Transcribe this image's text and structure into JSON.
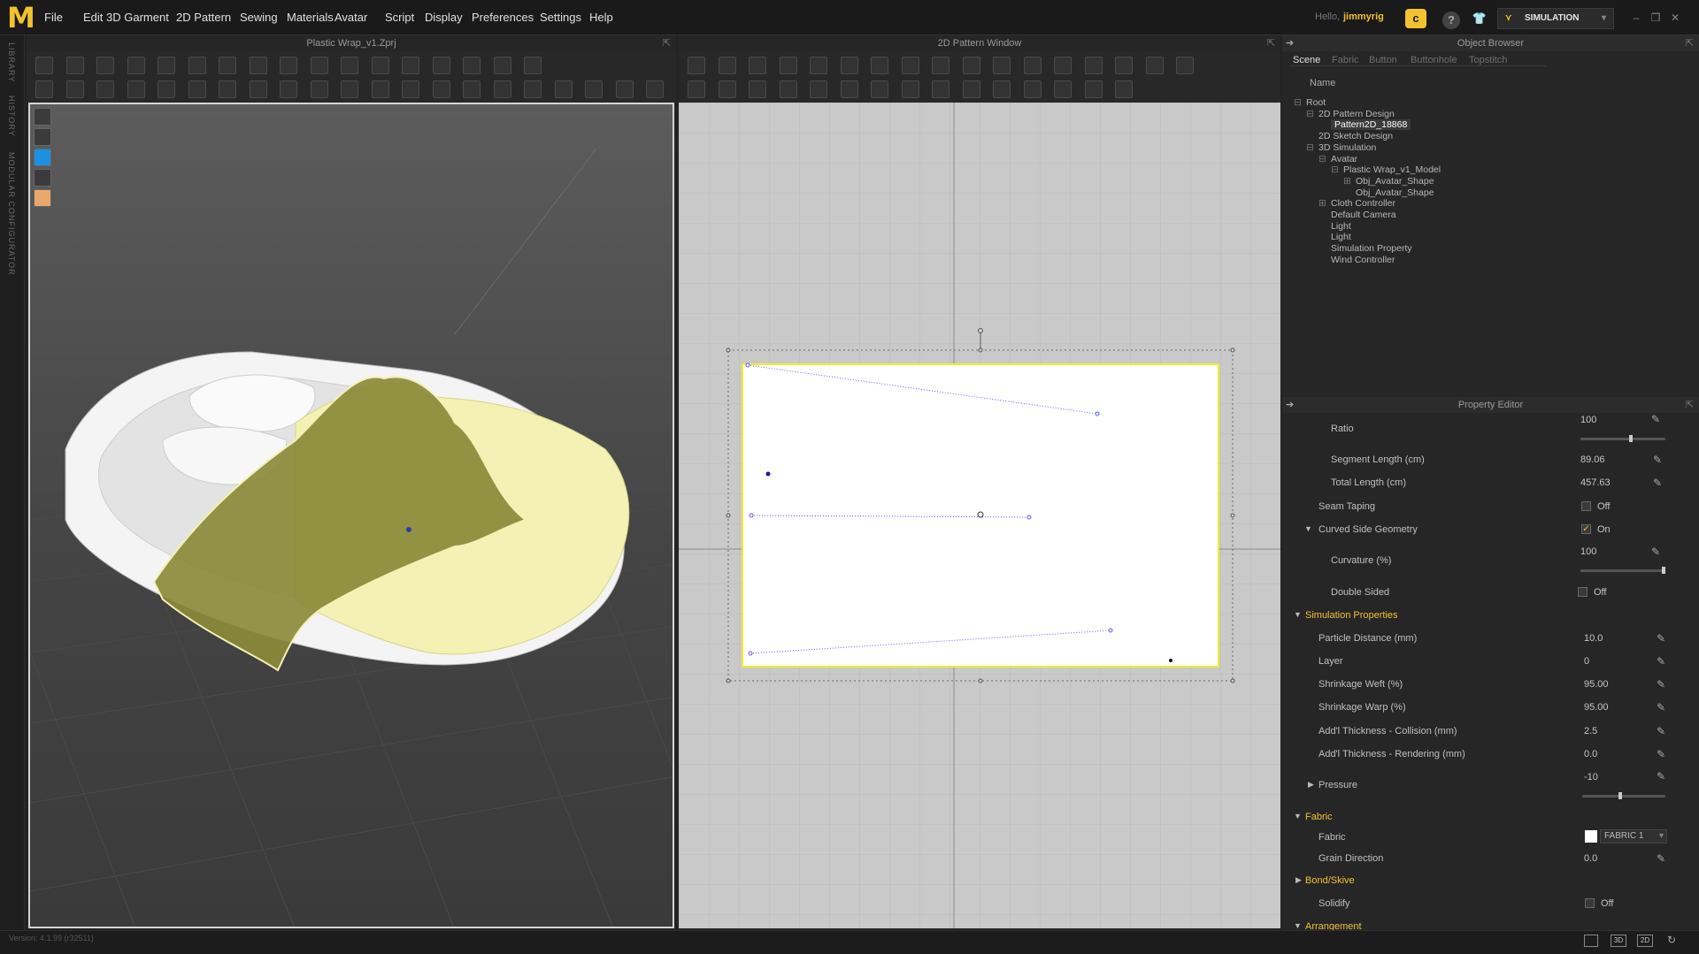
{
  "app": {
    "logo": "M",
    "greeting": "Hello,",
    "user": "jimmyrig",
    "mode": "SIMULATION"
  },
  "menu": [
    "File",
    "Edit",
    "3D Garment",
    "2D Pattern",
    "Sewing",
    "Materials",
    "Avatar",
    "Script",
    "Display",
    "Preferences",
    "Settings",
    "Help"
  ],
  "left_strip": {
    "labels": [
      "LIBRARY",
      "HISTORY",
      "MODULAR CONFIGURATOR"
    ]
  },
  "viewport3d": {
    "title": "Plastic Wrap_v1.Zprj"
  },
  "viewport2d": {
    "title": "2D Pattern Window"
  },
  "object_browser": {
    "title": "Object Browser",
    "tabs": [
      "Scene",
      "Fabric",
      "Button",
      "Buttonhole",
      "Topstitch"
    ],
    "active_tab": "Scene",
    "column": "Name",
    "tree": [
      {
        "label": "Root",
        "depth": 0,
        "toggle": "⊟"
      },
      {
        "label": "2D Pattern Design",
        "depth": 1,
        "toggle": "⊟"
      },
      {
        "label": "Pattern2D_18868",
        "depth": 2,
        "toggle": "",
        "selected": true
      },
      {
        "label": "2D Sketch Design",
        "depth": 1,
        "toggle": ""
      },
      {
        "label": "3D Simulation",
        "depth": 1,
        "toggle": "⊟"
      },
      {
        "label": "Avatar",
        "depth": 2,
        "toggle": "⊟"
      },
      {
        "label": "Plastic Wrap_v1_Model",
        "depth": 3,
        "toggle": "⊟"
      },
      {
        "label": "Obj_Avatar_Shape",
        "depth": 4,
        "toggle": "⊞"
      },
      {
        "label": "Obj_Avatar_Shape",
        "depth": 4,
        "toggle": ""
      },
      {
        "label": "Cloth Controller",
        "depth": 2,
        "toggle": "⊞"
      },
      {
        "label": "Default Camera",
        "depth": 2,
        "toggle": ""
      },
      {
        "label": "Light",
        "depth": 2,
        "toggle": ""
      },
      {
        "label": "Light",
        "depth": 2,
        "toggle": ""
      },
      {
        "label": "Simulation Property",
        "depth": 2,
        "toggle": ""
      },
      {
        "label": "Wind Controller",
        "depth": 2,
        "toggle": ""
      }
    ]
  },
  "property_editor": {
    "title": "Property Editor",
    "ratio": {
      "label": "Ratio",
      "value": "100",
      "level": 0.6
    },
    "segment_length": {
      "label": "Segment Length (cm)",
      "value": "89.06"
    },
    "total_length": {
      "label": "Total Length (cm)",
      "value": "457.63"
    },
    "seam_taping": {
      "label": "Seam Taping",
      "value": "Off"
    },
    "curved_side": {
      "label": "Curved Side Geometry",
      "value": "On"
    },
    "curvature": {
      "label": "Curvature (%)",
      "value": "100",
      "level": 1.0
    },
    "double_sided": {
      "label": "Double Sided",
      "value": "Off"
    },
    "sim_section": "Simulation Properties",
    "particle_distance": {
      "label": "Particle Distance (mm)",
      "value": "10.0"
    },
    "layer": {
      "label": "Layer",
      "value": "0"
    },
    "shrink_weft": {
      "label": "Shrinkage Weft (%)",
      "value": "95.00"
    },
    "shrink_warp": {
      "label": "Shrinkage Warp (%)",
      "value": "95.00"
    },
    "thick_collision": {
      "label": "Add'l Thickness - Collision (mm)",
      "value": "2.5"
    },
    "thick_render": {
      "label": "Add'l Thickness - Rendering (mm)",
      "value": "0.0"
    },
    "pressure": {
      "label": "Pressure",
      "value": "-10",
      "level": 0.45
    },
    "fabric_section": "Fabric",
    "fabric": {
      "label": "Fabric",
      "value": "FABRIC 1"
    },
    "grain": {
      "label": "Grain Direction",
      "value": "0.0"
    },
    "bond_section": "Bond/Skive",
    "solidify": {
      "label": "Solidify",
      "value": "Off"
    },
    "arrangement_section": "Arrangement"
  },
  "status": {
    "version": "Version: 4.1.99 (r32511)",
    "view_buttons": [
      "",
      "3D",
      "2D",
      ""
    ]
  },
  "colors": {
    "accent": "#f2c230",
    "cloth_dark": "#8a8a3a",
    "cloth_light": "#f3f1b4"
  }
}
